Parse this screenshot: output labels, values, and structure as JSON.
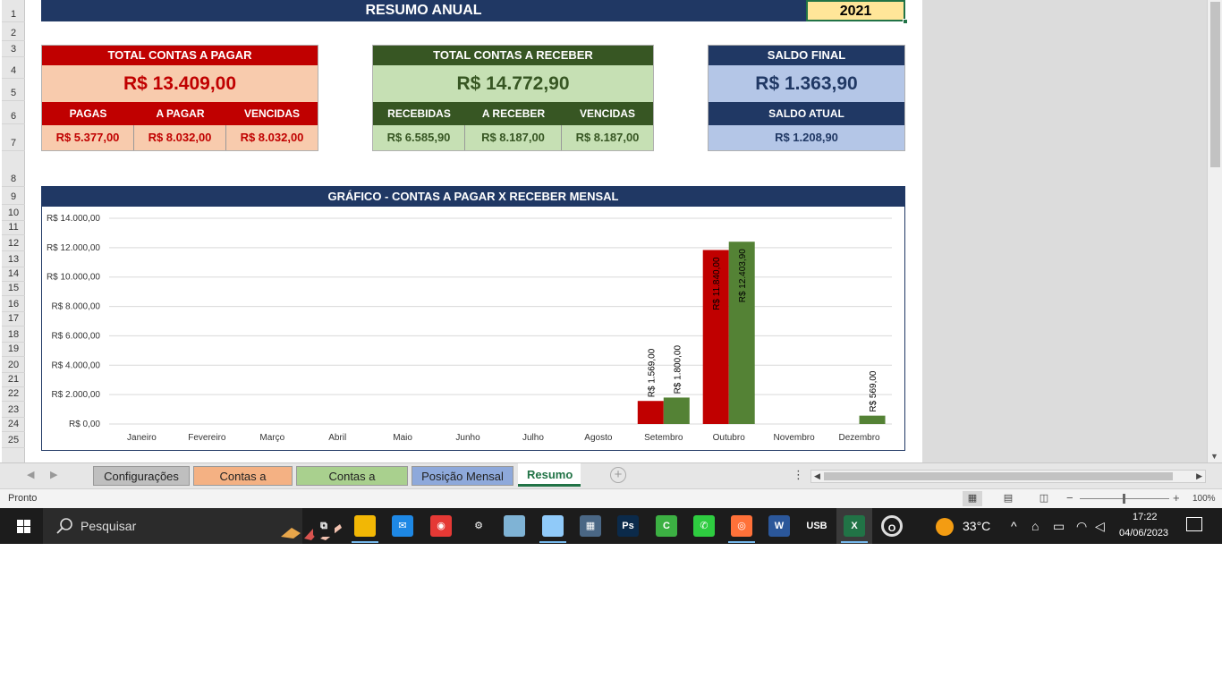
{
  "sheet": {
    "title": "RESUMO ANUAL",
    "year": "2021",
    "row_numbers": [
      "1",
      "2",
      "3",
      "4",
      "5",
      "6",
      "7",
      "8",
      "9",
      "10",
      "11",
      "12",
      "13",
      "14",
      "15",
      "16",
      "17",
      "18",
      "19",
      "20",
      "21",
      "22",
      "23",
      "24",
      "25"
    ]
  },
  "pagar": {
    "header": "TOTAL CONTAS A PAGAR",
    "total": "R$ 13.409,00",
    "sub_headers": [
      "PAGAS",
      "A PAGAR",
      "VENCIDAS"
    ],
    "sub_values": [
      "R$ 5.377,00",
      "R$ 8.032,00",
      "R$ 8.032,00"
    ],
    "color": "#c00000"
  },
  "receber": {
    "header": "TOTAL CONTAS A RECEBER",
    "total": "R$ 14.772,90",
    "sub_headers": [
      "RECEBIDAS",
      "A RECEBER",
      "VENCIDAS"
    ],
    "sub_values": [
      "R$ 6.585,90",
      "R$ 8.187,00",
      "R$ 8.187,00"
    ],
    "color": "#375623"
  },
  "saldo": {
    "header": "SALDO FINAL",
    "total": "R$ 1.363,90",
    "atual_header": "SALDO ATUAL",
    "atual_value": "R$ 1.208,90",
    "color": "#203864"
  },
  "chart_data": {
    "type": "bar",
    "title": "GRÁFICO - CONTAS A PAGAR X RECEBER MENSAL",
    "categories": [
      "Janeiro",
      "Fevereiro",
      "Março",
      "Abril",
      "Maio",
      "Junho",
      "Julho",
      "Agosto",
      "Setembro",
      "Outubro",
      "Novembro",
      "Dezembro"
    ],
    "series": [
      {
        "color": "#c00000",
        "values": [
          0,
          0,
          0,
          0,
          0,
          0,
          0,
          0,
          1569,
          11840,
          0,
          0
        ],
        "labels": [
          "",
          "",
          "",
          "",
          "",
          "",
          "",
          "",
          "R$ 1.569,00",
          "R$ 11.840,00",
          "",
          ""
        ]
      },
      {
        "color": "#548235",
        "values": [
          0,
          0,
          0,
          0,
          0,
          0,
          0,
          0,
          1800,
          12403.9,
          0,
          569
        ],
        "labels": [
          "",
          "",
          "",
          "",
          "",
          "",
          "",
          "",
          "R$ 1.800,00",
          "R$ 12.403,90",
          "",
          "R$ 569,00"
        ]
      }
    ],
    "ylim": [
      0,
      14000
    ],
    "yticks": [
      0,
      2000,
      4000,
      6000,
      8000,
      10000,
      12000,
      14000
    ],
    "ytick_labels": [
      "R$ 0,00",
      "R$ 2.000,00",
      "R$ 4.000,00",
      "R$ 6.000,00",
      "R$ 8.000,00",
      "R$ 10.000,00",
      "R$ 12.000,00",
      "R$ 14.000,00"
    ],
    "grid": true,
    "legend": "none"
  },
  "tabs": {
    "items": [
      {
        "label": "Configurações",
        "color": "#bfbfbf"
      },
      {
        "label": "Contas a Pagar",
        "color": "#f4b183"
      },
      {
        "label": "Contas a Receber",
        "color": "#a9d08e"
      },
      {
        "label": "Posição Mensal",
        "color": "#8ea9db"
      },
      {
        "label": "Resumo",
        "color": "#ffffff"
      }
    ],
    "add_symbol": "+",
    "more_symbol": "⋮"
  },
  "status": {
    "text": "Pronto",
    "zoom": "100%"
  },
  "taskbar": {
    "search_placeholder": "Pesquisar",
    "weather": "33°C",
    "time": "17:22",
    "date": "04/06/2023",
    "apps": [
      "task-view",
      "file-explorer",
      "mail",
      "chrome",
      "settings",
      "notepad",
      "paint",
      "calculator",
      "photoshop",
      "camtasia",
      "phone-app",
      "firefox",
      "word",
      "usb-util",
      "excel",
      "opera"
    ]
  }
}
